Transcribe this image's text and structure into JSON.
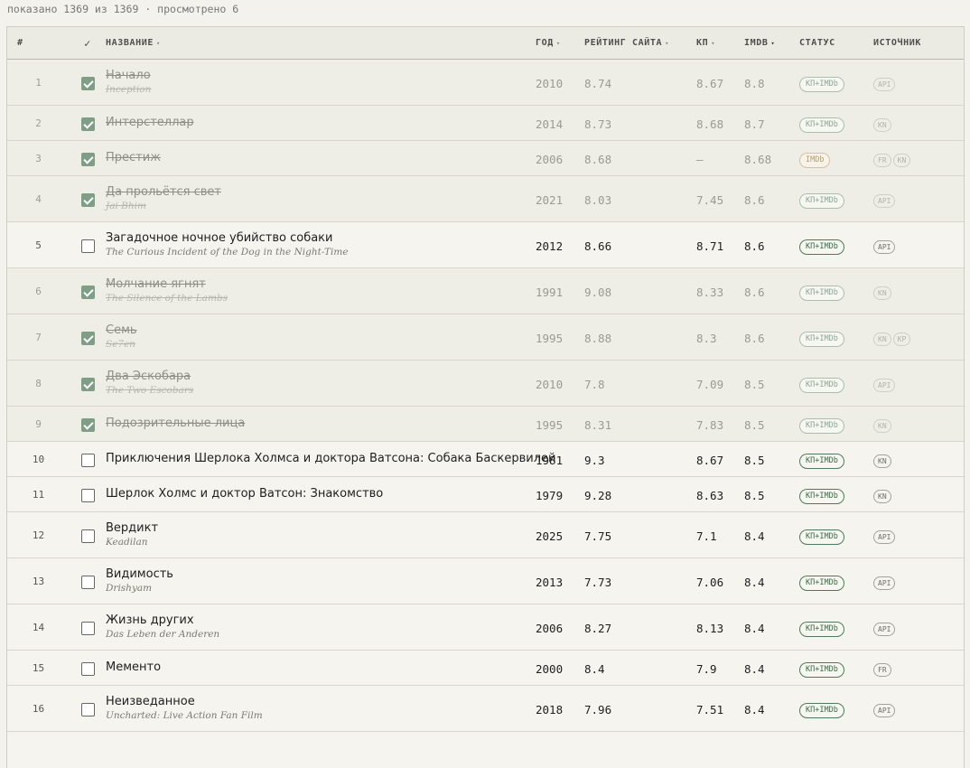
{
  "summary": "показано 1369 из 1369 · просмотрено 6",
  "headers": {
    "num": "#",
    "check": "✓",
    "title": "НАЗВАНИЕ",
    "year": "ГОД",
    "site_rating": "РЕЙТИНГ САЙТА",
    "kp": "КП",
    "imdb": "IMDB",
    "status": "СТАТУС",
    "source": "ИСТОЧНИК",
    "sort_glyph": "▾"
  },
  "rows": [
    {
      "num": "1",
      "checked": true,
      "title": "Начало",
      "orig": "Inception",
      "year": "2010",
      "site": "8.74",
      "kp": "8.67",
      "imdb": "8.8",
      "status": "КП+IMDb",
      "status_type": "both",
      "sources": [
        "API"
      ]
    },
    {
      "num": "2",
      "checked": true,
      "title": "Интерстеллар",
      "orig": "",
      "year": "2014",
      "site": "8.73",
      "kp": "8.68",
      "imdb": "8.7",
      "status": "КП+IMDb",
      "status_type": "both",
      "sources": [
        "KN"
      ]
    },
    {
      "num": "3",
      "checked": true,
      "title": "Престиж",
      "orig": "",
      "year": "2006",
      "site": "8.68",
      "kp": "—",
      "imdb": "8.68",
      "status": "IMDb",
      "status_type": "imdb",
      "sources": [
        "FR",
        "KN"
      ]
    },
    {
      "num": "4",
      "checked": true,
      "title": "Да прольётся свет",
      "orig": "Jai Bhim",
      "year": "2021",
      "site": "8.03",
      "kp": "7.45",
      "imdb": "8.6",
      "status": "КП+IMDb",
      "status_type": "both",
      "sources": [
        "API"
      ]
    },
    {
      "num": "5",
      "checked": false,
      "title": "Загадочное ночное убийство собаки",
      "orig": "The Curious Incident of the Dog in the Night-Time",
      "year": "2012",
      "site": "8.66",
      "kp": "8.71",
      "imdb": "8.6",
      "status": "КП+IMDb",
      "status_type": "both",
      "sources": [
        "API"
      ]
    },
    {
      "num": "6",
      "checked": true,
      "title": "Молчание ягнят",
      "orig": "The Silence of the Lambs",
      "year": "1991",
      "site": "9.08",
      "kp": "8.33",
      "imdb": "8.6",
      "status": "КП+IMDb",
      "status_type": "both",
      "sources": [
        "KN"
      ]
    },
    {
      "num": "7",
      "checked": true,
      "title": "Семь",
      "orig": "Se7en",
      "year": "1995",
      "site": "8.88",
      "kp": "8.3",
      "imdb": "8.6",
      "status": "КП+IMDb",
      "status_type": "both",
      "sources": [
        "KN",
        "KP"
      ]
    },
    {
      "num": "8",
      "checked": true,
      "title": "Два Эскобара",
      "orig": "The Two Escobars",
      "year": "2010",
      "site": "7.8",
      "kp": "7.09",
      "imdb": "8.5",
      "status": "КП+IMDb",
      "status_type": "both",
      "sources": [
        "API"
      ]
    },
    {
      "num": "9",
      "checked": true,
      "title": "Подозрительные лица",
      "orig": "",
      "year": "1995",
      "site": "8.31",
      "kp": "7.83",
      "imdb": "8.5",
      "status": "КП+IMDb",
      "status_type": "both",
      "sources": [
        "KN"
      ]
    },
    {
      "num": "10",
      "checked": false,
      "title": "Приключения Шерлока Холмса и доктора Ватсона: Собака Баскервилей",
      "orig": "",
      "year": "1981",
      "site": "9.3",
      "kp": "8.67",
      "imdb": "8.5",
      "status": "КП+IMDb",
      "status_type": "both",
      "sources": [
        "KN"
      ]
    },
    {
      "num": "11",
      "checked": false,
      "title": "Шерлок Холмс и доктор Ватсон: Знакомство",
      "orig": "",
      "year": "1979",
      "site": "9.28",
      "kp": "8.63",
      "imdb": "8.5",
      "status": "КП+IMDb",
      "status_type": "both",
      "sources": [
        "KN"
      ]
    },
    {
      "num": "12",
      "checked": false,
      "title": "Вердикт",
      "orig": "Keadilan",
      "year": "2025",
      "site": "7.75",
      "kp": "7.1",
      "imdb": "8.4",
      "status": "КП+IMDb",
      "status_type": "both",
      "sources": [
        "API"
      ]
    },
    {
      "num": "13",
      "checked": false,
      "title": "Видимость",
      "orig": "Drishyam",
      "year": "2013",
      "site": "7.73",
      "kp": "7.06",
      "imdb": "8.4",
      "status": "КП+IMDb",
      "status_type": "both",
      "sources": [
        "API"
      ]
    },
    {
      "num": "14",
      "checked": false,
      "title": "Жизнь других",
      "orig": "Das Leben der Anderen",
      "year": "2006",
      "site": "8.27",
      "kp": "8.13",
      "imdb": "8.4",
      "status": "КП+IMDb",
      "status_type": "both",
      "sources": [
        "API"
      ]
    },
    {
      "num": "15",
      "checked": false,
      "title": "Мементо",
      "orig": "",
      "year": "2000",
      "site": "8.4",
      "kp": "7.9",
      "imdb": "8.4",
      "status": "КП+IMDb",
      "status_type": "both",
      "sources": [
        "FR"
      ]
    },
    {
      "num": "16",
      "checked": false,
      "title": "Неизведанное",
      "orig": "Uncharted: Live Action Fan Film",
      "year": "2018",
      "site": "7.96",
      "kp": "7.51",
      "imdb": "8.4",
      "status": "КП+IMDb",
      "status_type": "both",
      "sources": [
        "API"
      ]
    }
  ]
}
